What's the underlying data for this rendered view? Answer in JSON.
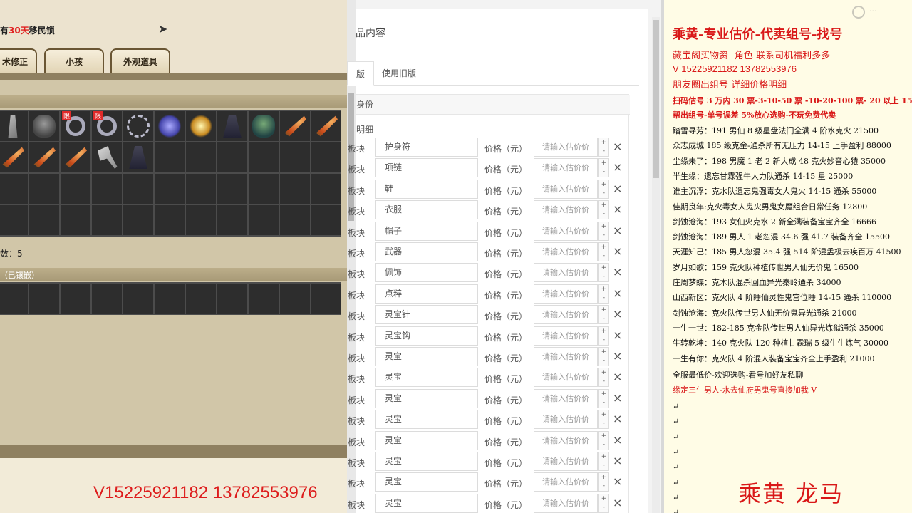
{
  "game": {
    "title_pre": "有",
    "title_highlight": "30天",
    "title_post": "移民锁",
    "tabs": [
      "术修正",
      "小孩",
      "外观道具"
    ],
    "limit_badge": "限",
    "item_count": "数：5",
    "embedded_header": "（已镶嵌）",
    "inventory_row1": [
      "blade-icon",
      "mask-icon",
      "ring-icon",
      "ring-icon",
      "swirl-icon",
      "sprite-icon",
      "glow-icon",
      "cloth-icon",
      "helm-icon",
      "feather-icon",
      "feather-icon"
    ],
    "inventory_row2": [
      "feather-icon",
      "feather-icon",
      "feather-icon",
      "axe-icon",
      "cloth-icon"
    ]
  },
  "overlay": {
    "phone": "V15225921182   13782553976"
  },
  "form": {
    "title": "品内容",
    "tab_active": "版",
    "tab_old": "使用旧版",
    "card_header": "身份",
    "detail_label": "明细",
    "row_label": "板块",
    "price_label": "价格（元）",
    "price_placeholder": "请输入估价价",
    "stepper_up": "+",
    "stepper_down": "-",
    "delete_symbol": "×",
    "parts": [
      "护身符",
      "项链",
      "鞋",
      "衣服",
      "帽子",
      "武器",
      "佩饰",
      "点粹",
      "灵宝针",
      "灵宝钩",
      "灵宝",
      "灵宝",
      "灵宝",
      "灵宝",
      "灵宝",
      "灵宝",
      "灵宝",
      "灵宝",
      "灵宝"
    ]
  },
  "notes": {
    "title": "乘黄-专业估价-代卖组号-找号",
    "line2": "藏宝阁买物资--角色-联系司机福利多多",
    "line3": "V 15225921182    13782553976",
    "line4": "朋友圈出组号    详细价格明细",
    "line5": "扫码估号 3 万内 30 票-3-10-50 票  -10-20-100 票- 20 以上 150",
    "line6": "帮出组号-单号误差 5%放心选购-不玩免费代卖",
    "listings": [
      "踏雪寻芳：191 男仙 8 级星盘法门全满 4 阶水克火 21500",
      "众志成城  185 级克金-通杀所有无压力 14-15 上手盈利 88000",
      "尘缘未了：198 男魔 1 老 2 新大成 48 克火妙音心猿 35000",
      "半生缘：遗忘甘霖强牛大力队通杀 14-15 星 25000",
      "谁主沉浮：克水队遗忘鬼强毒女人鬼火 14-15 通杀 55000",
      "佳期良年:克火毒女人鬼火男鬼女魔组合日常任务 12800",
      "剑蚀沧海：193 女仙火克水 2 新全满装备宝宝齐全 16666",
      "剑蚀沧海：189 男人 1 老忽混 34.6 强 41.7 装备齐全 15500",
      "天涯知己：185 男人忽混 35.4 强 514 阶混孟极去疾百万 41500",
      "岁月如歌：159 克火队种植传世男人仙无价鬼 16500",
      "庄周梦蝶：克木队混杀回血异光秦岭通杀 34000",
      "山西新区：克火队 4 阶睡仙灵性鬼宫位睡 14-15 通杀 110000",
      "剑蚀沧海：克火队传世男人仙无价鬼异光通杀 21000",
      "一生一世：182-185 克金队传世男人仙异光炼狱通杀 35000",
      "牛转乾坤：140 克火队 120 种植甘霖瑞 5 级生生炼气 30000",
      "一生有你：克火队 4 阶混人装备宝宝齐全上手盈利 21000"
    ],
    "footer1": "全服最低价-欢迎选购-看号加好友私聊",
    "footer2": "缘定三生男人-水去仙府男鬼号直接加我 V",
    "return_mark": "↵",
    "signature": "乘黄  龙马"
  },
  "colors": {
    "accent_red": "#d91818",
    "game_bg": "#ece3cf",
    "notes_bg": "#fffce6"
  }
}
